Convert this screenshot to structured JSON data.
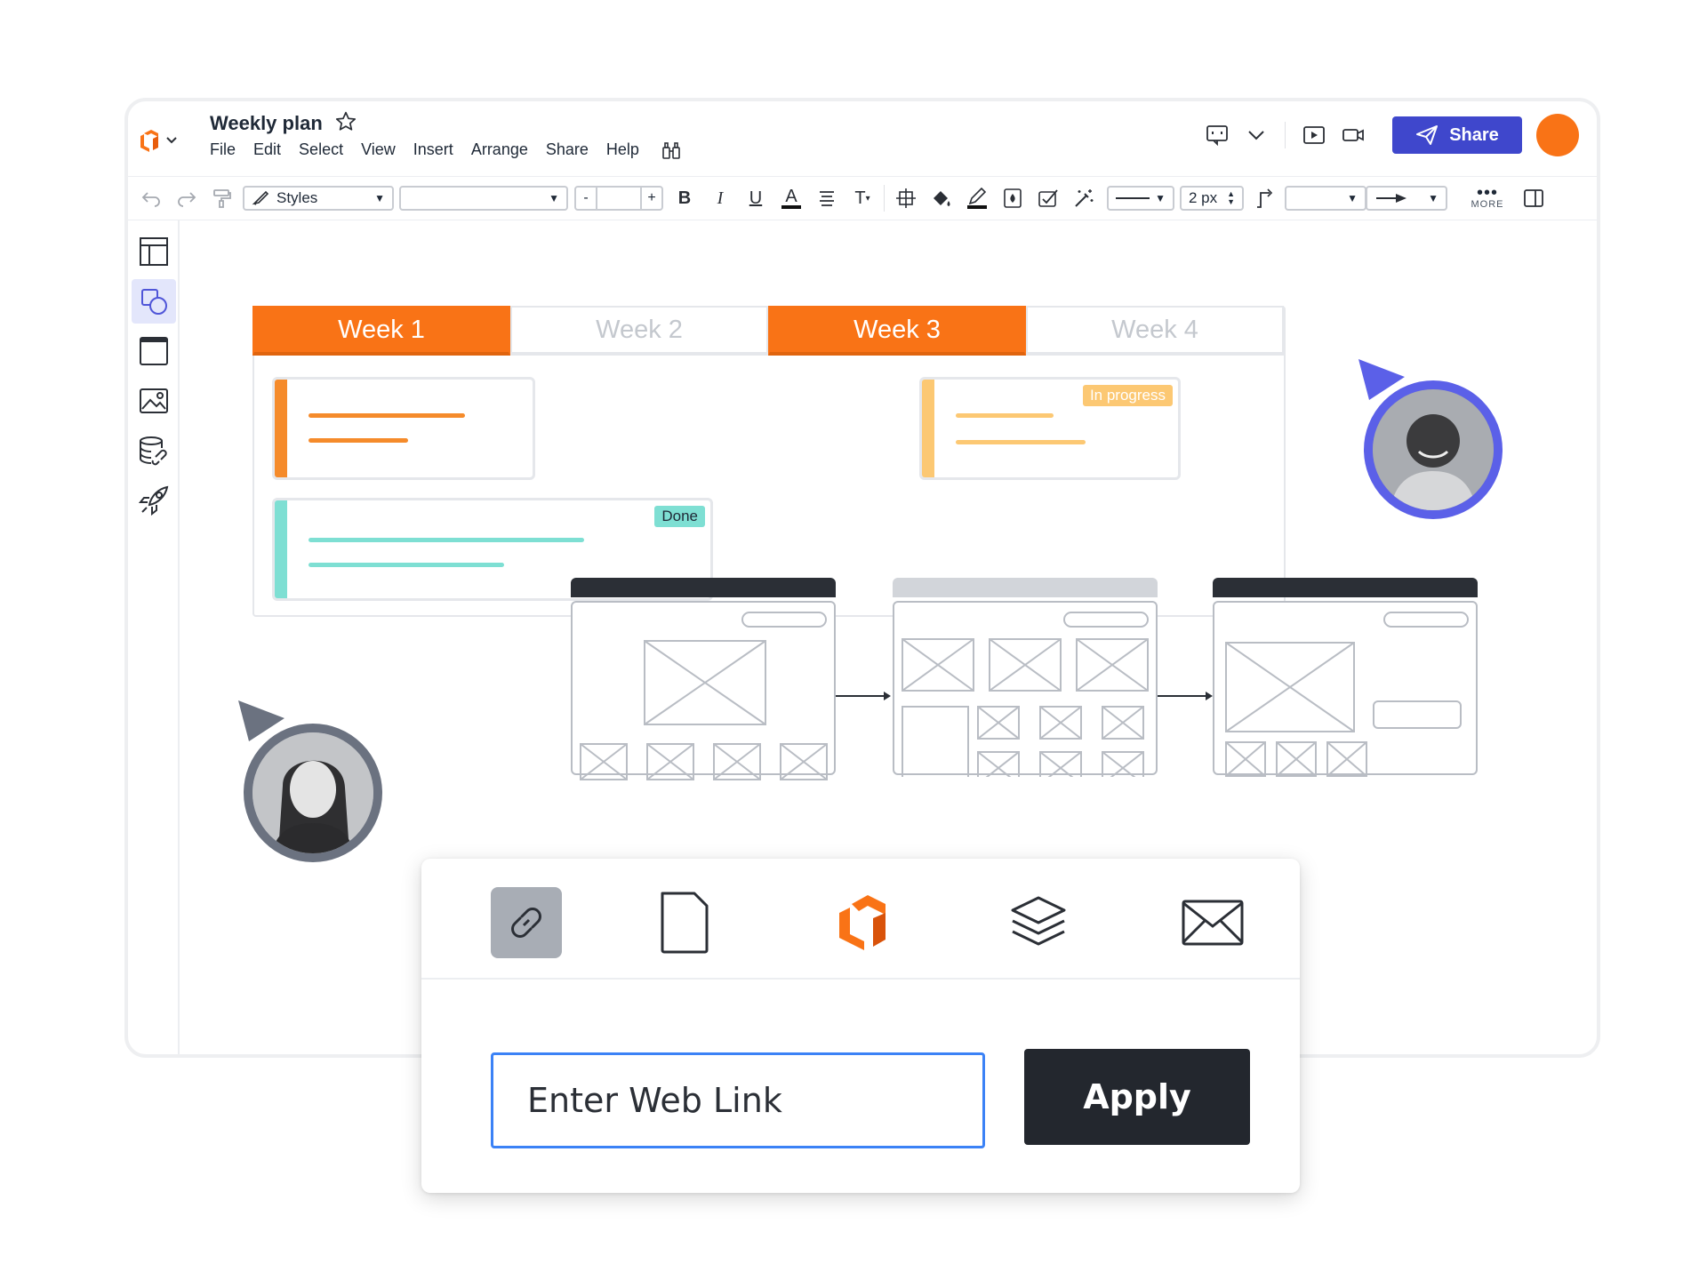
{
  "document": {
    "title": "Weekly plan"
  },
  "menu": [
    "File",
    "Edit",
    "Select",
    "View",
    "Insert",
    "Arrange",
    "Share",
    "Help"
  ],
  "header": {
    "share_label": "Share",
    "avatar_color": "#f97316",
    "accent_color": "#3f47cc"
  },
  "toolbar": {
    "style_select": "Styles",
    "font_select": "",
    "font_size": "",
    "bold": "B",
    "italic": "I",
    "underline": "U",
    "font_color": "A",
    "text_options": "T",
    "line_width": "2 px",
    "more_label": "MORE",
    "icons": [
      "undo-icon",
      "redo-icon",
      "format-painter-icon",
      "bold-icon",
      "italic-icon",
      "underline-icon",
      "font-color-icon",
      "align-icon",
      "text-options-icon",
      "shape-options-icon",
      "fill-icon",
      "line-color-icon",
      "opacity-icon",
      "conditional-format-icon",
      "magic-wand-icon",
      "line-style-icon",
      "waypoint-icon",
      "arrow-end-icon",
      "panel-toggle-icon"
    ]
  },
  "sidebar": {
    "items": [
      {
        "icon": "templates-icon",
        "active": false
      },
      {
        "icon": "shapes-icon",
        "active": true
      },
      {
        "icon": "frame-icon",
        "active": false
      },
      {
        "icon": "image-icon",
        "active": false
      },
      {
        "icon": "data-link-icon",
        "active": false
      },
      {
        "icon": "rocket-icon",
        "active": false
      }
    ]
  },
  "board": {
    "weeks": [
      {
        "label": "Week 1",
        "highlighted": true
      },
      {
        "label": "Week 2",
        "highlighted": false
      },
      {
        "label": "Week 3",
        "highlighted": true
      },
      {
        "label": "Week 4",
        "highlighted": false
      }
    ],
    "cards": [
      {
        "status": "",
        "color": "#f58b2b"
      },
      {
        "status": "In progress",
        "color": "#fcc873"
      },
      {
        "status": "Done",
        "color": "#7edfd3"
      }
    ]
  },
  "wireframes": [
    {
      "header_color": "#2b2f36"
    },
    {
      "header_color": "#d2d5da"
    },
    {
      "header_color": "#2b2f36"
    }
  ],
  "collaborators": [
    {
      "name": "",
      "ring_color": "#5b60e8"
    },
    {
      "name": "",
      "ring_color": "#6b7280"
    }
  ],
  "insert_link_dialog": {
    "tabs": [
      "link-icon",
      "document-icon",
      "lucid-icon",
      "layers-icon",
      "mail-icon"
    ],
    "selected_tab": "link-icon",
    "input_placeholder": "Enter Web Link",
    "input_value": "",
    "apply_label": "Apply"
  }
}
